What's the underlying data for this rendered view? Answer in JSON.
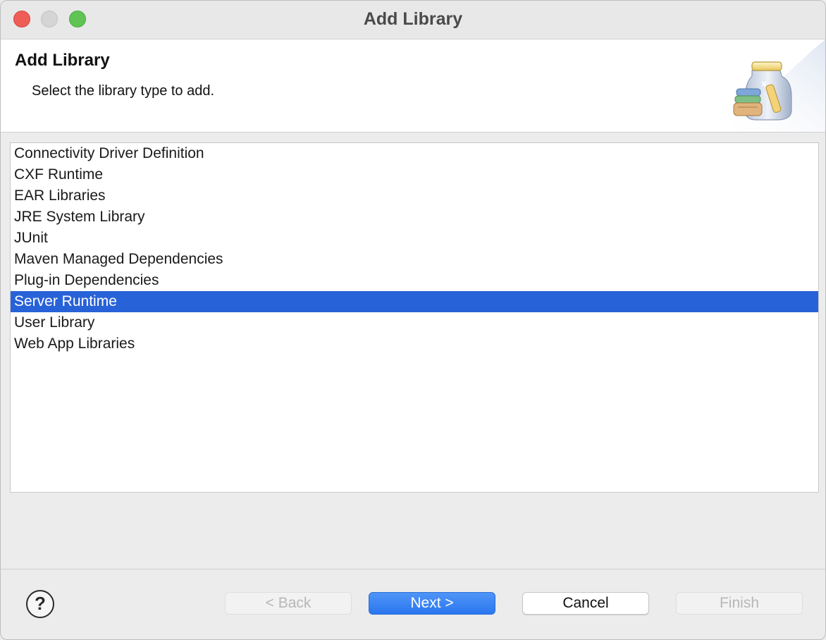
{
  "window": {
    "title": "Add Library"
  },
  "banner": {
    "title": "Add Library",
    "description": "Select the library type to add.",
    "icon": "library-jar-icon"
  },
  "library_types": [
    {
      "label": "Connectivity Driver Definition",
      "selected": false
    },
    {
      "label": "CXF Runtime",
      "selected": false
    },
    {
      "label": "EAR Libraries",
      "selected": false
    },
    {
      "label": "JRE System Library",
      "selected": false
    },
    {
      "label": "JUnit",
      "selected": false
    },
    {
      "label": "Maven Managed Dependencies",
      "selected": false
    },
    {
      "label": "Plug-in Dependencies",
      "selected": false
    },
    {
      "label": "Server Runtime",
      "selected": true
    },
    {
      "label": "User Library",
      "selected": false
    },
    {
      "label": "Web App Libraries",
      "selected": false
    }
  ],
  "footer": {
    "help_glyph": "?",
    "back_label": "< Back",
    "next_label": "Next >",
    "cancel_label": "Cancel",
    "finish_label": "Finish",
    "back_enabled": false,
    "finish_enabled": false
  },
  "colors": {
    "selection": "#2862d8",
    "primary_button": "#2a76ef",
    "close": "#ee5e57",
    "minimize": "#d5d5d5",
    "zoom": "#5fc454"
  }
}
